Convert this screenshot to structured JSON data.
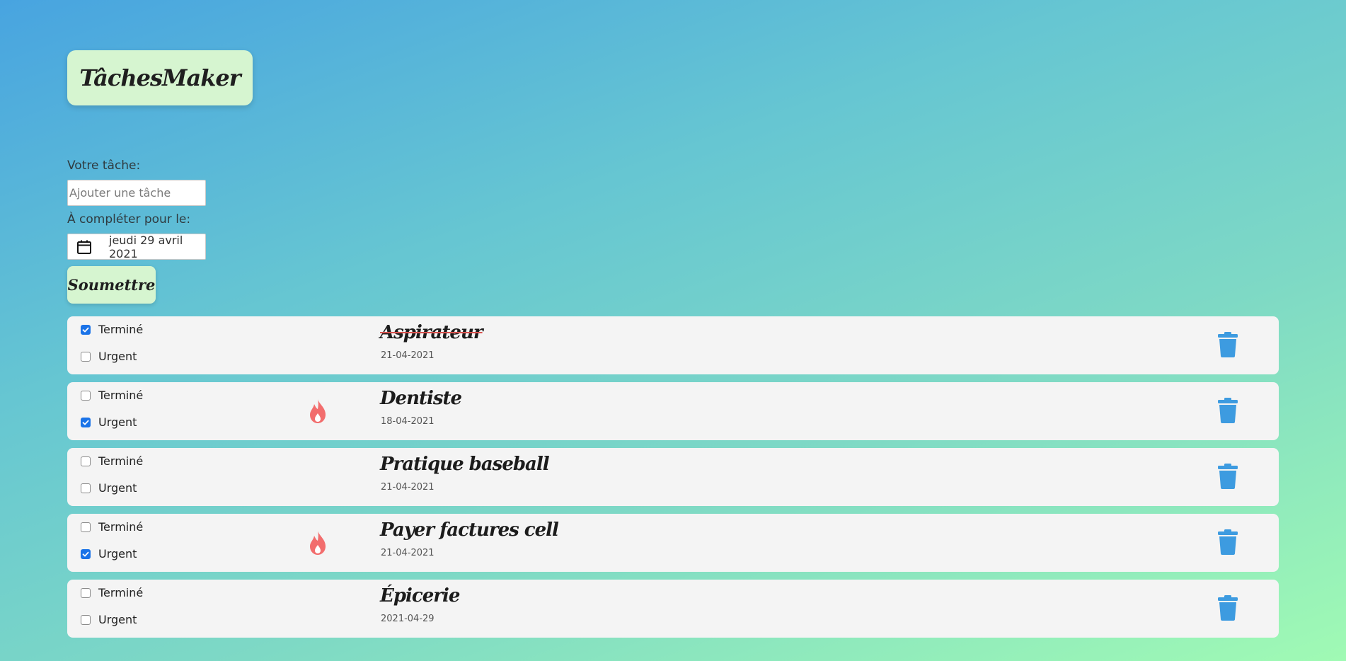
{
  "app": {
    "logo_text": "TâchesMaker"
  },
  "form": {
    "task_label": "Votre tâche:",
    "task_placeholder": "Ajouter une tâche",
    "task_value": "",
    "date_label": "À compléter pour le:",
    "date_value": "jeudi 29 avril 2021",
    "submit_label": "Soumettre"
  },
  "labels": {
    "done": "Terminé",
    "urgent": "Urgent"
  },
  "tasks": [
    {
      "title": "Aspirateur",
      "date": "21-04-2021",
      "done": true,
      "urgent": false
    },
    {
      "title": "Dentiste",
      "date": "18-04-2021",
      "done": false,
      "urgent": true
    },
    {
      "title": "Pratique baseball",
      "date": "21-04-2021",
      "done": false,
      "urgent": false
    },
    {
      "title": "Payer factures cell",
      "date": "21-04-2021",
      "done": false,
      "urgent": true
    },
    {
      "title": "Épicerie",
      "date": "2021-04-29",
      "done": false,
      "urgent": false
    }
  ],
  "icons": {
    "calendar": "calendar-icon",
    "urgent": "flame-icon",
    "delete": "trash-icon"
  },
  "colors": {
    "accent_green": "#d6f5d0",
    "checkbox_blue": "#1a73e8",
    "flame": "#f26d6d",
    "trash": "#3d9be0",
    "strike": "#d9534f"
  }
}
